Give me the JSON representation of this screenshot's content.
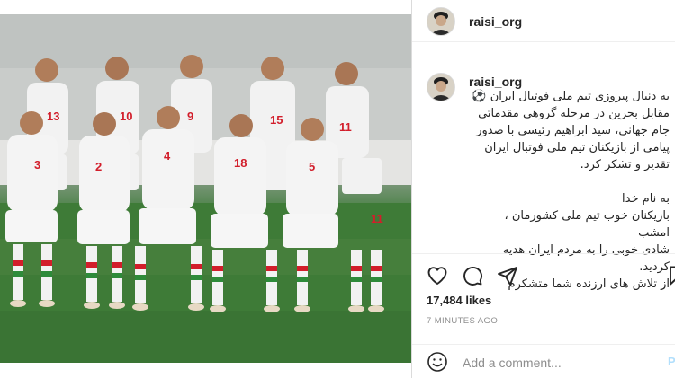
{
  "post": {
    "username": "raisi_org",
    "caption_username": "raisi_org",
    "caption_lines": [
      "به دنبال پیروزی تیم ملی فوتبال ایران ⚽",
      "مقابل بحرین در مرحله گروهی مقدماتی",
      "جام جهانی، سید ابراهیم رئیسی با صدور",
      "پیامی از بازیکنان تیم ملی فوتبال ایران",
      "تقدیر و تشکر کرد."
    ],
    "message_lines": [
      "به نام خدا",
      "بازیکنان خوب تیم ملی کشورمان ، امشب",
      "شادی خوبی را به مردم ایران هدیه کردید.",
      "از تلاش های ارزنده شما متشکرم"
    ],
    "likes": "17,484 likes",
    "time": "7 MINUTES AGO",
    "comment_placeholder": "Add a comment...",
    "post_button": "P"
  },
  "photo": {
    "jersey_numbers": [
      "13",
      "10",
      "9",
      "15",
      "11",
      "3",
      "2",
      "4",
      "18",
      "5",
      "15",
      "11"
    ]
  },
  "icons": {
    "like": "heart-icon",
    "comment": "comment-icon",
    "share": "share-icon",
    "save": "bookmark-icon",
    "emoji": "emoji-icon"
  },
  "colors": {
    "border": "#dbdbdb",
    "muted": "#8e8e8e",
    "post_button": "#b2dffc"
  }
}
